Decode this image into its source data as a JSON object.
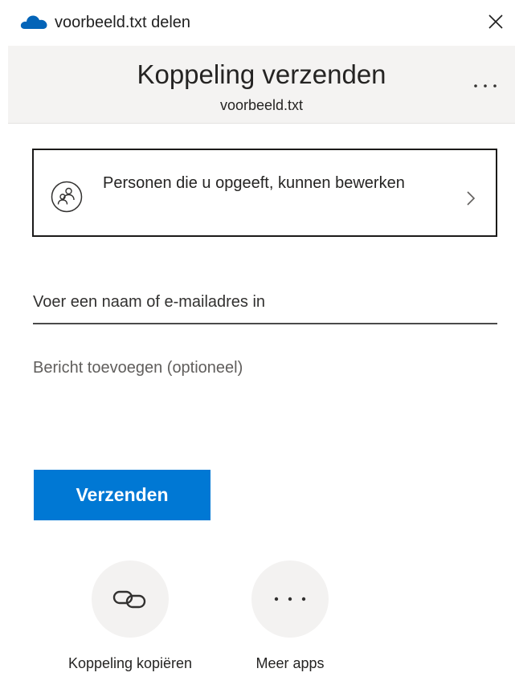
{
  "window": {
    "title": "voorbeeld.txt delen",
    "app_icon": "onedrive-cloud-icon",
    "close_icon": "close-icon"
  },
  "header": {
    "title": "Koppeling verzenden",
    "subtitle": "voorbeeld.txt",
    "more_icon": "more-options-icon"
  },
  "permissions": {
    "text": "Personen die u opgeeft, kunnen bewerken",
    "icon": "people-icon",
    "chevron_icon": "chevron-right-icon"
  },
  "recipient": {
    "placeholder": "Voer een naam of e-mailadres in",
    "value": ""
  },
  "message": {
    "placeholder": "Bericht toevoegen (optioneel)",
    "value": ""
  },
  "send_button": {
    "label": "Verzenden"
  },
  "actions": [
    {
      "label": "Koppeling kopiëren",
      "icon": "link-icon"
    },
    {
      "label": "Meer apps",
      "icon": "more-apps-icon"
    }
  ],
  "colors": {
    "accent": "#0078d4",
    "header_bg": "#f4f3f2",
    "action_circle_bg": "#f3f2f1",
    "cloud": "#0364b8"
  }
}
